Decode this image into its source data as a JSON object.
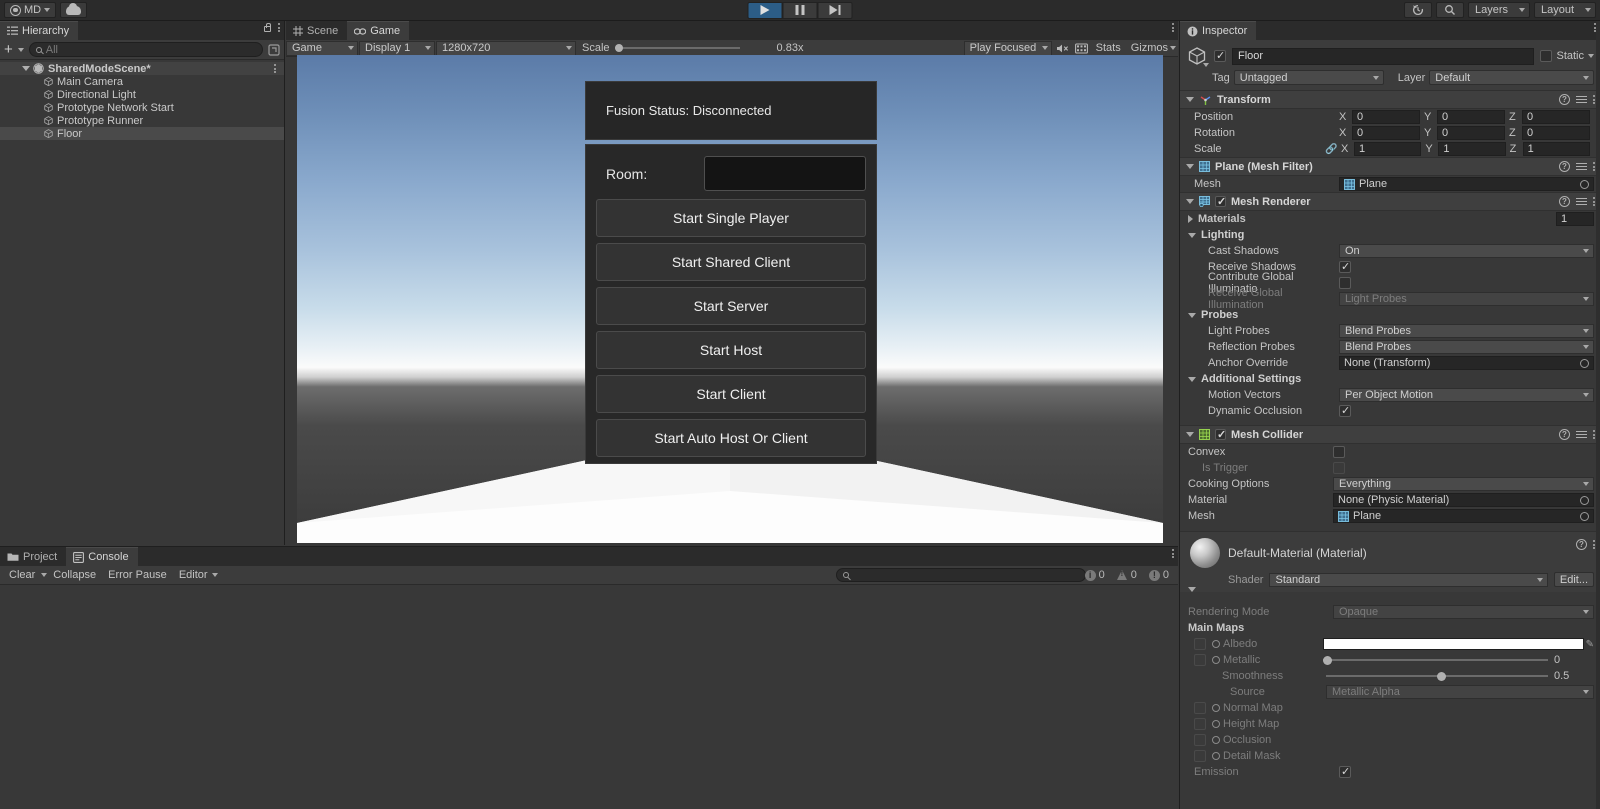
{
  "topbar": {
    "account_label": "MD",
    "icons": [
      "account-icon",
      "cloud-icon",
      "history-icon",
      "search-icon"
    ],
    "layers_label": "Layers",
    "layout_label": "Layout",
    "playback": {
      "play": "play-icon",
      "pause": "pause-icon",
      "step": "step-icon"
    }
  },
  "hierarchy": {
    "tab_label": "Hierarchy",
    "search_placeholder": "All",
    "create_label": "+",
    "items": [
      {
        "label": "SharedModeScene*",
        "depth": 0,
        "type": "scene",
        "expanded": true,
        "selected": false
      },
      {
        "label": "Main Camera",
        "depth": 1,
        "type": "gameobject",
        "selected": false
      },
      {
        "label": "Directional Light",
        "depth": 1,
        "type": "gameobject",
        "selected": false
      },
      {
        "label": "Prototype Network Start",
        "depth": 1,
        "type": "gameobject",
        "selected": false
      },
      {
        "label": "Prototype Runner",
        "depth": 1,
        "type": "gameobject",
        "selected": false
      },
      {
        "label": "Floor",
        "depth": 1,
        "type": "gameobject",
        "selected": true
      }
    ]
  },
  "center": {
    "tabs": [
      {
        "label": "Scene",
        "active": false,
        "icon": "grid-icon"
      },
      {
        "label": "Game",
        "active": true,
        "icon": "gamepad-icon"
      }
    ],
    "game_toolbar": {
      "view_mode": "Game",
      "display": "Display 1",
      "resolution": "1280x720",
      "scale_label": "Scale",
      "scale_value": "0.83x",
      "play_mode": "Play Focused",
      "mute_icon": "mute-audio-icon",
      "stats_label": "Stats",
      "gizmos_label": "Gizmos"
    }
  },
  "game_ui": {
    "status_text": "Fusion Status: Disconnected",
    "room_label": "Room:",
    "room_value": "",
    "buttons": [
      "Start Single Player",
      "Start Shared Client",
      "Start Server",
      "Start Host",
      "Start Client",
      "Start Auto Host Or Client"
    ]
  },
  "inspector": {
    "tab_label": "Inspector",
    "object": {
      "name": "Floor",
      "enabled": true,
      "static_label": "Static",
      "static_checked": false,
      "tag_label": "Tag",
      "tag_value": "Untagged",
      "layer_label": "Layer",
      "layer_value": "Default"
    },
    "components": [
      {
        "name": "Transform",
        "icon": "transform-icon",
        "rows": [
          {
            "label": "Position",
            "type": "vector3",
            "x": "0",
            "y": "0",
            "z": "0"
          },
          {
            "label": "Rotation",
            "type": "vector3",
            "x": "0",
            "y": "0",
            "z": "0"
          },
          {
            "label": "Scale",
            "type": "vector3",
            "x": "1",
            "y": "1",
            "z": "1",
            "link": true
          }
        ]
      },
      {
        "name": "Plane (Mesh Filter)",
        "icon": "mesh-filter-icon",
        "rows": [
          {
            "label": "Mesh",
            "type": "object",
            "value": "Plane"
          }
        ]
      },
      {
        "name": "Mesh Renderer",
        "icon": "mesh-renderer-icon",
        "enabled": true,
        "rows": [
          {
            "label": "Materials",
            "type": "foldout-closed",
            "value": "1"
          },
          {
            "label": "Lighting",
            "type": "section"
          },
          {
            "label": "Cast Shadows",
            "type": "dropdown",
            "value": "On",
            "indent": true
          },
          {
            "label": "Receive Shadows",
            "type": "checkbox",
            "checked": true,
            "indent": true
          },
          {
            "label": "Contribute Global Illuminatio",
            "type": "checkbox",
            "checked": false,
            "indent": true
          },
          {
            "label": "Receive Global Illumination",
            "type": "dropdown",
            "value": "Light Probes",
            "indent": true,
            "disabled": true
          },
          {
            "label": "Probes",
            "type": "section"
          },
          {
            "label": "Light Probes",
            "type": "dropdown",
            "value": "Blend Probes",
            "indent": true
          },
          {
            "label": "Reflection Probes",
            "type": "dropdown",
            "value": "Blend Probes",
            "indent": true
          },
          {
            "label": "Anchor Override",
            "type": "object",
            "value": "None (Transform)",
            "indent": true
          },
          {
            "label": "Additional Settings",
            "type": "section"
          },
          {
            "label": "Motion Vectors",
            "type": "dropdown",
            "value": "Per Object Motion",
            "indent": true
          },
          {
            "label": "Dynamic Occlusion",
            "type": "checkbox",
            "checked": true,
            "indent": true
          }
        ]
      },
      {
        "name": "Mesh Collider",
        "icon": "mesh-collider-icon",
        "enabled": true,
        "rows": [
          {
            "label": "Convex",
            "type": "checkbox",
            "checked": false
          },
          {
            "label": "Is Trigger",
            "type": "checkbox",
            "checked": false,
            "disabled": true,
            "indent": true
          },
          {
            "label": "Cooking Options",
            "type": "dropdown",
            "value": "Everything"
          },
          {
            "label": "Material",
            "type": "object",
            "value": "None (Physic Material)"
          },
          {
            "label": "Mesh",
            "type": "object",
            "value": "Plane"
          }
        ]
      }
    ],
    "material": {
      "title": "Default-Material (Material)",
      "shader_label": "Shader",
      "shader_value": "Standard",
      "edit_label": "Edit...",
      "rendering_mode_label": "Rendering Mode",
      "rendering_mode_value": "Opaque",
      "main_maps_label": "Main Maps",
      "props": [
        {
          "label": "Albedo",
          "type": "color",
          "color": "#ffffff"
        },
        {
          "label": "Metallic",
          "type": "slider",
          "value": "0",
          "pct": 0
        },
        {
          "label": "Smoothness",
          "type": "slider",
          "value": "0.5",
          "pct": 50,
          "indent": true
        },
        {
          "label": "Source",
          "type": "dropdown",
          "value": "Metallic Alpha",
          "indent": true
        },
        {
          "label": "Normal Map",
          "type": "tex"
        },
        {
          "label": "Height Map",
          "type": "tex"
        },
        {
          "label": "Occlusion",
          "type": "tex"
        },
        {
          "label": "Detail Mask",
          "type": "tex"
        },
        {
          "label": "Emission",
          "type": "checkbox",
          "checked": true
        }
      ]
    }
  },
  "bottom": {
    "tabs": [
      {
        "label": "Project",
        "active": false,
        "icon": "folder-icon"
      },
      {
        "label": "Console",
        "active": true,
        "icon": "console-icon"
      }
    ],
    "toolbar": {
      "clear_label": "Clear",
      "collapse_label": "Collapse",
      "error_pause_label": "Error Pause",
      "editor_label": "Editor"
    },
    "counters": {
      "log_count": "0",
      "warning_count": "0",
      "error_count": "0"
    }
  }
}
